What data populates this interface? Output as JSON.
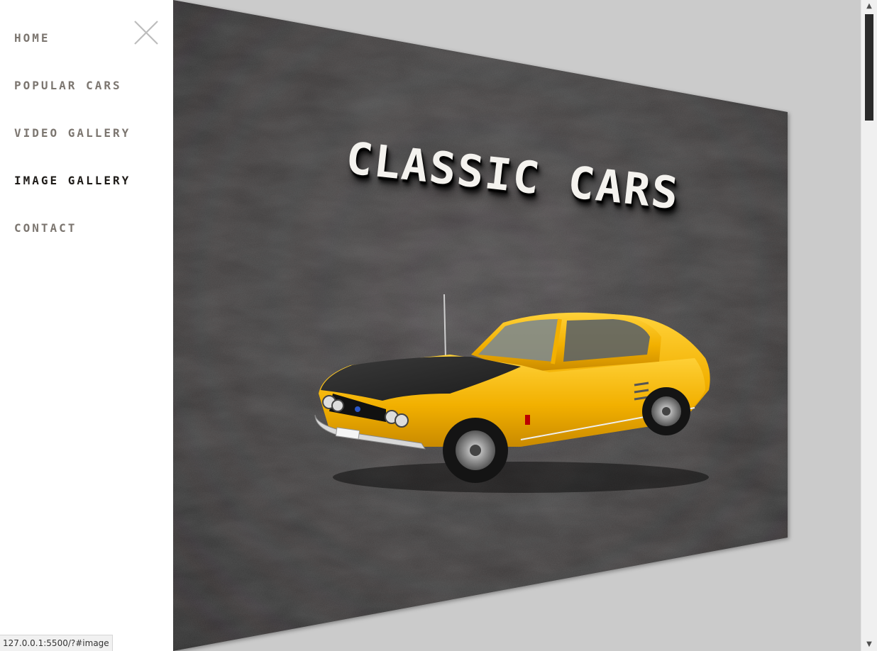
{
  "menu": {
    "items": [
      {
        "label": "HOME",
        "active": false
      },
      {
        "label": "POPULAR CARS",
        "active": false
      },
      {
        "label": "VIDEO GALLERY",
        "active": false
      },
      {
        "label": "IMAGE GALLERY",
        "active": true
      },
      {
        "label": "CONTACT",
        "active": false
      }
    ],
    "close_icon": "close-icon"
  },
  "hero": {
    "title": "CLASSIC CARS",
    "image": "yellow-classic-car"
  },
  "status_bar": {
    "url": "127.0.0.1:5500/?#image"
  },
  "colors": {
    "menu_text": "#7c7670",
    "menu_active": "#1e1b18",
    "board": "#3a3839",
    "car_yellow": "#f4b90c",
    "page_bg": "#cbcbcb"
  }
}
